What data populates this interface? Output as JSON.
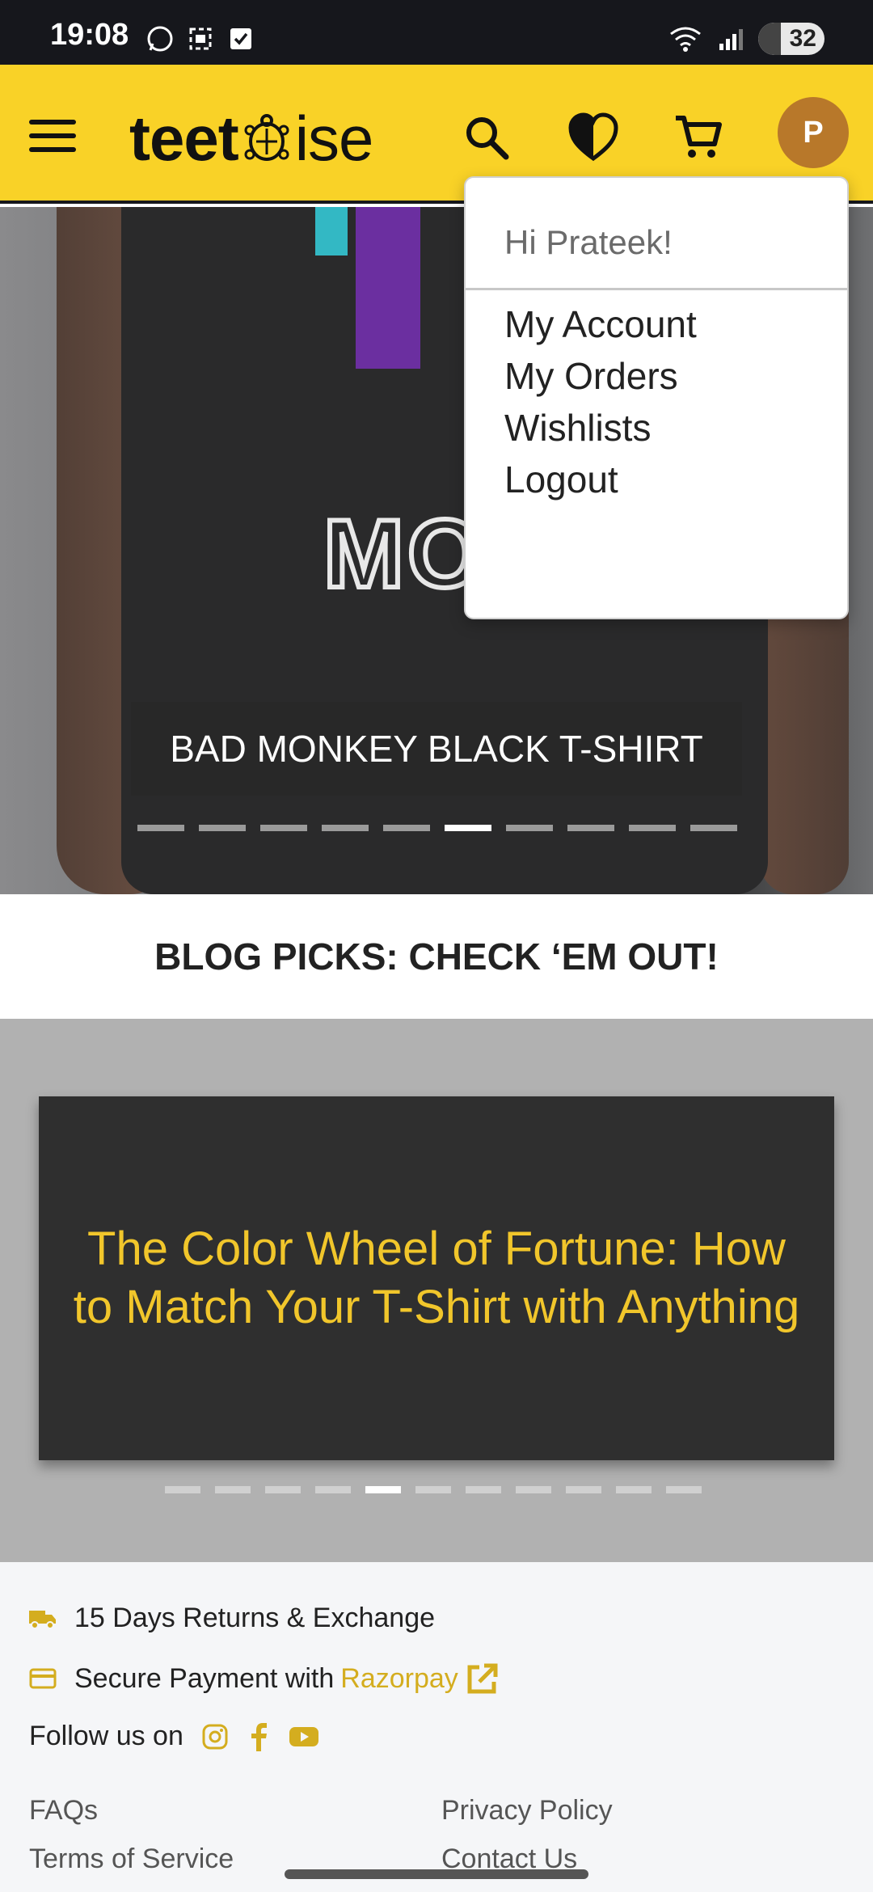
{
  "status_bar": {
    "time": "19:08",
    "battery": "32"
  },
  "header": {
    "logo_part1": "teet",
    "logo_part2": "ise",
    "avatar_initial": "P"
  },
  "hero": {
    "caption": "BAD MONKEY BLACK T-SHIRT",
    "slide_count": 10,
    "active_slide": 5
  },
  "dropdown": {
    "greeting": "Hi Prateek!",
    "items": [
      "My Account",
      "My Orders",
      "Wishlists",
      "Logout"
    ]
  },
  "blog": {
    "heading": "BLOG PICKS: CHECK ‘EM OUT!",
    "card_title": "The Color Wheel of Fortune: How to Match Your T-Shirt with Anything",
    "slide_count": 11,
    "active_slide": 4
  },
  "footer": {
    "returns": "15 Days Returns & Exchange",
    "secure_payment": "Secure Payment with",
    "payment_brand": "Razorpay",
    "follow": "Follow us on",
    "links": [
      "FAQs",
      "Privacy Policy",
      "Terms of Service",
      "Contact Us"
    ]
  },
  "colors": {
    "brand_yellow": "#f9d227",
    "accent_gold": "#d4ad1f",
    "avatar": "#b8782a"
  }
}
